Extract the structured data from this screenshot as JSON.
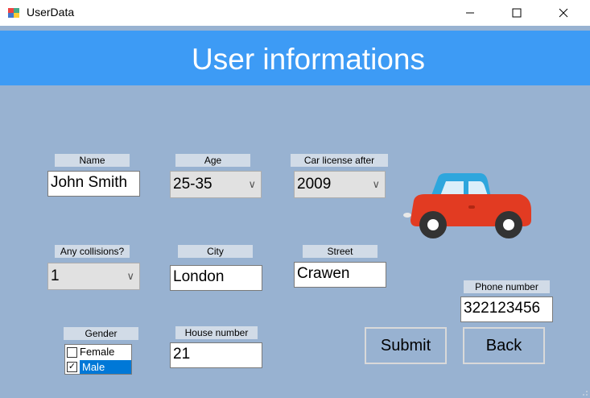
{
  "window": {
    "title": "UserData",
    "minimize": "—",
    "maximize": "☐",
    "close": "✕"
  },
  "banner": {
    "title": "User informations"
  },
  "fields": {
    "name": {
      "label": "Name",
      "value": "John Smith"
    },
    "age": {
      "label": "Age",
      "value": "25-35"
    },
    "car_license": {
      "label": "Car license after",
      "value": "2009"
    },
    "collisions": {
      "label": "Any collisions?",
      "value": "1"
    },
    "city": {
      "label": "City",
      "value": "London"
    },
    "street": {
      "label": "Street",
      "value": "Crawen"
    },
    "phone": {
      "label": "Phone number",
      "value": "322123456"
    },
    "gender": {
      "label": "Gender",
      "options": [
        "Female",
        "Male"
      ],
      "checked": "Male"
    },
    "house": {
      "label": "House number",
      "value": "21"
    }
  },
  "buttons": {
    "submit": "Submit",
    "back": "Back"
  },
  "icons": {
    "car": "car-icon",
    "app": "app-icon"
  },
  "colors": {
    "background": "#98b2d1",
    "banner": "#3d9bf5",
    "label_bg": "#d1dbe7",
    "selection": "#0078d7",
    "car_body": "#e23b22"
  }
}
